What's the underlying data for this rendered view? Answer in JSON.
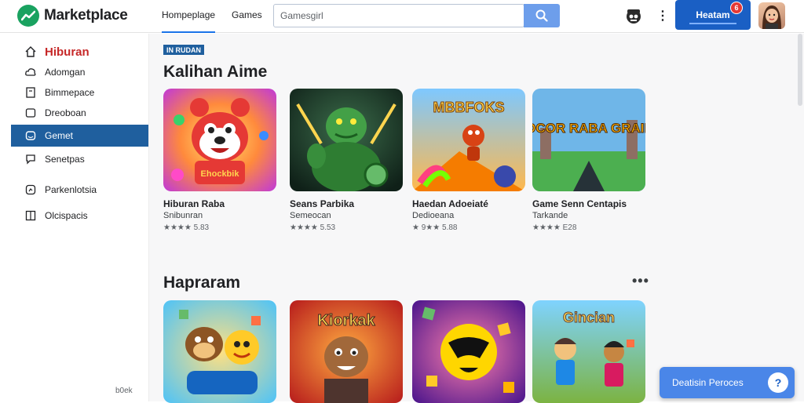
{
  "header": {
    "logo_text": "Marketplace",
    "nav_tabs": [
      {
        "label": "Hompeplage",
        "active": true
      },
      {
        "label": "Games",
        "active": false
      }
    ],
    "search": {
      "value": "Gamesgirl",
      "icon": "search-icon"
    },
    "account_button_label": "Heatam",
    "notification_count": "6",
    "more_icon": "kebab-icon"
  },
  "sidebar": {
    "items": [
      {
        "label": "Hiburan",
        "icon": "home-icon",
        "type": "header"
      },
      {
        "label": "Adomgan",
        "icon": "cloud-icon"
      },
      {
        "label": "Bimmepace",
        "icon": "book-icon"
      },
      {
        "label": "Dreoboan",
        "icon": "folder-icon"
      },
      {
        "label": "Gemet",
        "icon": "gamepad-icon",
        "active": true
      },
      {
        "label": "Senetpas",
        "icon": "chat-icon"
      },
      {
        "label": "Parkenlotsia",
        "icon": "clock-icon"
      },
      {
        "label": "Olcispacis",
        "icon": "box-icon"
      }
    ],
    "footer_text": "b0ek"
  },
  "main": {
    "tag": "IN RUDAN",
    "sections": [
      {
        "title": "Kalihan Aime",
        "cards": [
          {
            "title": "Hiburan Raba",
            "subtitle": "Snibunran",
            "rating": "★★★★ 5.83"
          },
          {
            "title": "Seans Parbika",
            "subtitle": "Semeocan",
            "rating": "★★★★ 5.53"
          },
          {
            "title": "Haedan Adoeiaté",
            "subtitle": "Dedioeana",
            "rating": "★ 9★★ 5.88"
          },
          {
            "title": "Game Senn Centapis",
            "subtitle": "Tarkande",
            "rating": "★★★★ E28"
          }
        ]
      },
      {
        "title": "Hapraram",
        "cards": [
          {
            "title": "",
            "subtitle": "",
            "rating": ""
          },
          {
            "title": "",
            "subtitle": "",
            "rating": ""
          },
          {
            "title": "",
            "subtitle": "",
            "rating": ""
          },
          {
            "title": "",
            "subtitle": "",
            "rating": ""
          }
        ]
      }
    ],
    "thumb_art_text": [
      "Ehockbik",
      "MBBFOKS",
      "GOCOR RABA GRAINS",
      "Kiorkak",
      "Gincian"
    ]
  },
  "help_button": {
    "label": "Deatisin Peroces",
    "icon": "question-icon"
  }
}
